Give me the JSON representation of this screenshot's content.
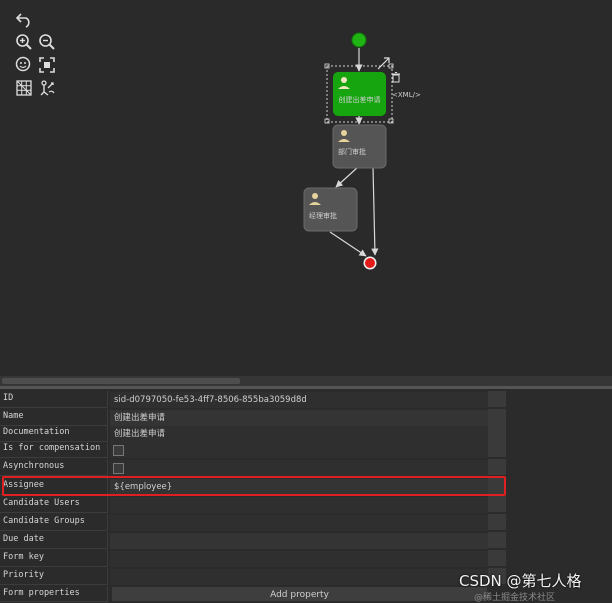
{
  "diagram": {
    "nodes": [
      {
        "label": "创建出差申请"
      },
      {
        "label": "部门审批"
      },
      {
        "label": "经理审批"
      }
    ],
    "xml_label": "<XML/>"
  },
  "properties": [
    {
      "name": "ID",
      "value": "sid-d0797050-fe53-4ff7-8506-855ba3059d8d",
      "kind": "text"
    },
    {
      "name": "Name",
      "value": "创建出差申请",
      "kind": "text"
    },
    {
      "name": "Documentation",
      "value": "创建出差申请",
      "kind": "text"
    },
    {
      "name": "Is for compensation",
      "value": "",
      "kind": "checkbox"
    },
    {
      "name": "Asynchronous",
      "value": "",
      "kind": "checkbox"
    },
    {
      "name": "Assignee",
      "value": "${employee}",
      "kind": "text"
    },
    {
      "name": "Candidate Users",
      "value": "",
      "kind": "text"
    },
    {
      "name": "Candidate Groups",
      "value": "",
      "kind": "text"
    },
    {
      "name": "Due date",
      "value": "",
      "kind": "text"
    },
    {
      "name": "Form key",
      "value": "",
      "kind": "text"
    },
    {
      "name": "Priority",
      "value": "",
      "kind": "text"
    },
    {
      "name": "Form properties",
      "value": "",
      "kind": "text"
    }
  ],
  "add_property_label": "Add property",
  "watermark": "CSDN @第七人格",
  "watermark_sub": "@稀土掘金技术社区",
  "colors": {
    "start_event": "#1fb314",
    "end_event": "#e21b1b",
    "selected_task": "#16a50f",
    "task": "#555555",
    "highlight": "#e02020"
  }
}
